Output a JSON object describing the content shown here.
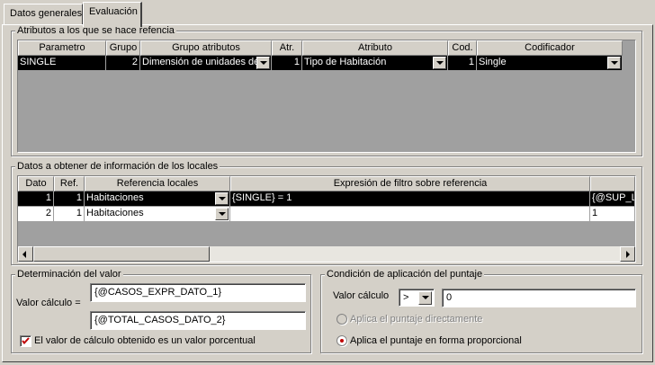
{
  "tabs": [
    {
      "label": "Datos generales",
      "active": false
    },
    {
      "label": "Evaluación",
      "active": true
    }
  ],
  "attributes_group": {
    "title": "Atributos a los que se hace refencia",
    "columns": [
      "Parametro",
      "Grupo",
      "Grupo atributos",
      "Atr.",
      "Atributo",
      "Cod.",
      "Codificador"
    ],
    "rows": [
      {
        "parametro": "SINGLE",
        "grupo": "2",
        "grupo_atributos": "Dimensión de unidades de",
        "atr": "1",
        "atributo": "Tipo de Habitación",
        "cod": "1",
        "codificador": "Single"
      }
    ]
  },
  "locales_group": {
    "title": "Datos a obtener de información de los locales",
    "columns": [
      "Dato",
      "Ref.",
      "Referencia locales",
      "Expresión de filtro sobre referencia",
      ""
    ],
    "rows": [
      {
        "dato": "1",
        "ref": "1",
        "referencia": "Habitaciones",
        "expresion": "{SINGLE} = 1",
        "extra": "{@SUP_L"
      },
      {
        "dato": "2",
        "ref": "1",
        "referencia": "Habitaciones",
        "expresion": "",
        "extra": "1"
      }
    ]
  },
  "determinacion_group": {
    "title": "Determinación del valor",
    "valor_label": "Valor cálculo =",
    "numerator": "{@CASOS_EXPR_DATO_1}",
    "denominator": "{@TOTAL_CASOS_DATO_2}",
    "percent_checkbox_label": "El valor de cálculo obtenido es un valor porcentual",
    "percent_checked": true
  },
  "condicion_group": {
    "title": "Condición de aplicación del puntaje",
    "valor_label": "Valor cálculo",
    "operator": ">",
    "value": "0",
    "radio_direct_label": "Aplica el puntaje directamente",
    "radio_proportional_label": "Aplica el puntaje en forma proporcional"
  },
  "colors": {
    "face": "#d4d0c8",
    "selection": "#000000",
    "check_mark": "#c00000"
  }
}
